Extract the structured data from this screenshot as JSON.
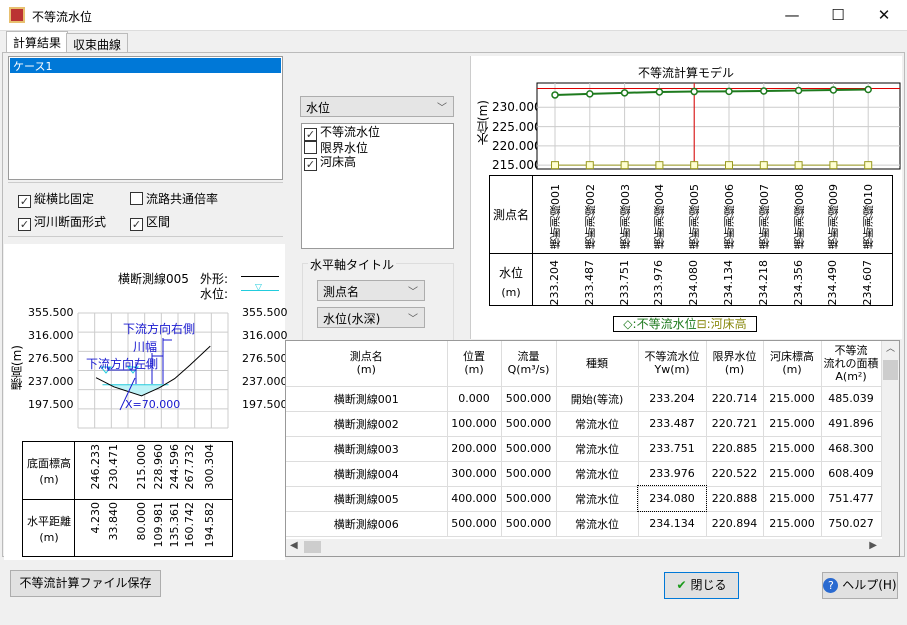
{
  "window": {
    "title": "不等流水位",
    "min": "—",
    "max": "☐",
    "close": "✕"
  },
  "tabs": [
    {
      "label": "計算結果"
    },
    {
      "label": "収束曲線"
    }
  ],
  "cases": [
    "ケース1"
  ],
  "options": [
    {
      "label": "縦横比固定",
      "checked": true
    },
    {
      "label": "流路共通倍率",
      "checked": false
    },
    {
      "label": "河川断面形式",
      "checked": true
    },
    {
      "label": "区間",
      "checked": true
    }
  ],
  "section": {
    "title": "横断測線005",
    "legend_shape": "外形:",
    "legend_water": "水位:",
    "ylabel": "標高(m)",
    "yticks": [
      "355.500",
      "316.000",
      "276.500",
      "237.000",
      "197.500"
    ],
    "annotations": {
      "right": "下流方向右側",
      "width": "川幅",
      "left": "下流方向左側",
      "x": "X=70.000"
    },
    "water_level": 234.08,
    "profile": {
      "distance": [
        4.23,
        33.84,
        80.0,
        109.981,
        135.361,
        160.742,
        194.582
      ],
      "elevation": [
        246.233,
        230.471,
        215.0,
        228.96,
        244.596,
        267.732,
        300.304
      ]
    },
    "row_elev": "底面標高",
    "row_dist": "水平距離",
    "unit": "(m)",
    "elev_labels": [
      "246.233",
      "230.471",
      "215.000",
      "228.960",
      "244.596",
      "267.732",
      "300.304"
    ],
    "dist_labels": [
      "4.230",
      "33.840",
      "80.000",
      "109.981",
      "135.361",
      "160.742",
      "194.582"
    ]
  },
  "middle": {
    "select": "水位",
    "series": [
      {
        "label": "不等流水位",
        "checked": true
      },
      {
        "label": "限界水位",
        "checked": false
      },
      {
        "label": "河床高",
        "checked": true
      }
    ],
    "group": "水平軸タイトル",
    "axis_select": "測点名",
    "value_select": "水位(水深)"
  },
  "chart_data": {
    "type": "line",
    "title": "不等流計算モデル",
    "ylabel": "水位(m)",
    "ylim": [
      214,
      236.3
    ],
    "yticks": [
      215,
      220,
      225,
      230
    ],
    "categories": [
      "横断測線001",
      "横断測線002",
      "横断測線003",
      "横断測線004",
      "横断測線005",
      "横断測線006",
      "横断測線007",
      "横断測線008",
      "横断測線009",
      "横断測線010"
    ],
    "series": [
      {
        "name": "不等流水位",
        "color": "#1e7a1e",
        "values": [
          233.204,
          233.487,
          233.751,
          233.976,
          234.08,
          234.134,
          234.218,
          234.356,
          234.49,
          234.607
        ]
      },
      {
        "name": "河床高",
        "color": "#9a9a20",
        "values": [
          215,
          215,
          215,
          215,
          215,
          215,
          215,
          215,
          215,
          215
        ]
      }
    ],
    "selected_index": 4,
    "row_name": "測点名",
    "row_value": "水位",
    "row_unit": "(m)",
    "value_labels": [
      "233.204",
      "233.487",
      "233.751",
      "233.976",
      "234.080",
      "234.134",
      "234.218",
      "234.356",
      "234.490",
      "234.607"
    ],
    "legend": {
      "wl": "◇:不等流水位",
      "bed": "⊟:河床高"
    }
  },
  "grid": {
    "headers": [
      [
        "測点名",
        "(m)"
      ],
      [
        "位置",
        "(m)"
      ],
      [
        "流量",
        "Q(m³/s)"
      ],
      [
        "種類",
        ""
      ],
      [
        "不等流水位",
        "Yw(m)"
      ],
      [
        "限界水位",
        "(m)"
      ],
      [
        "河床標高",
        "(m)"
      ],
      [
        "不等流\n流れの面積",
        "A(m²)"
      ]
    ],
    "rows": [
      [
        "横断測線001",
        "0.000",
        "500.000",
        "開始(等流)",
        "233.204",
        "220.714",
        "215.000",
        "485.039"
      ],
      [
        "横断測線002",
        "100.000",
        "500.000",
        "常流水位",
        "233.487",
        "220.721",
        "215.000",
        "491.896"
      ],
      [
        "横断測線003",
        "200.000",
        "500.000",
        "常流水位",
        "233.751",
        "220.885",
        "215.000",
        "468.300"
      ],
      [
        "横断測線004",
        "300.000",
        "500.000",
        "常流水位",
        "233.976",
        "220.522",
        "215.000",
        "608.409"
      ],
      [
        "横断測線005",
        "400.000",
        "500.000",
        "常流水位",
        "234.080",
        "220.888",
        "215.000",
        "751.477"
      ],
      [
        "横断測線006",
        "500.000",
        "500.000",
        "常流水位",
        "234.134",
        "220.894",
        "215.000",
        "750.027"
      ]
    ]
  },
  "buttons": {
    "save": "不等流計算ファイル保存",
    "close": "閉じる",
    "help": "ヘルプ(H)"
  }
}
